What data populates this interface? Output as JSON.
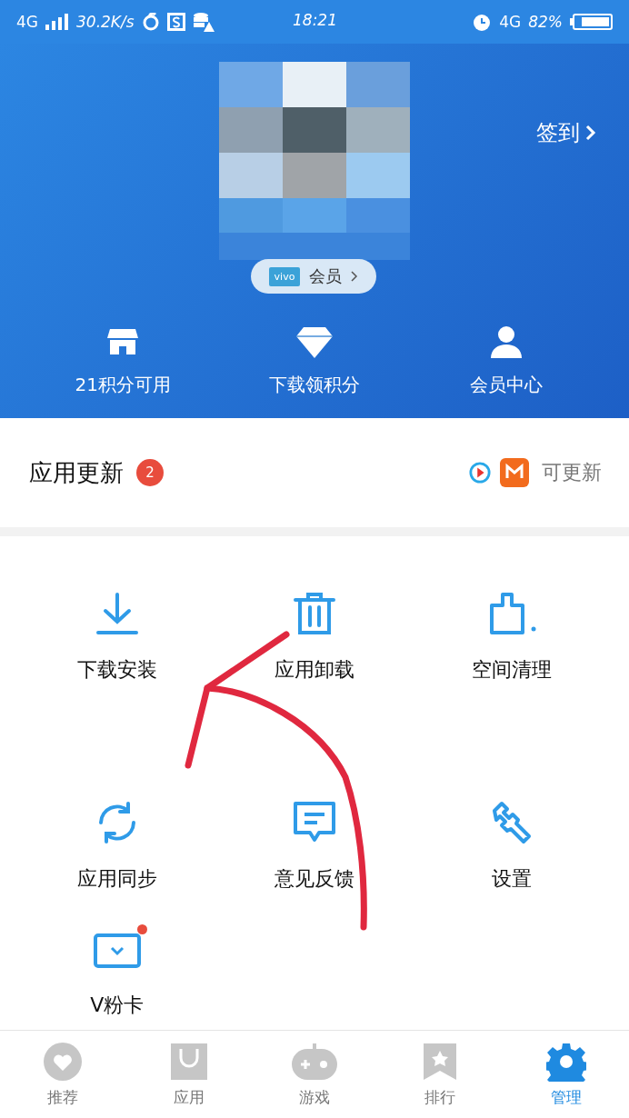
{
  "status_bar": {
    "network": "4G",
    "speed": "30.2K/s",
    "time": "18:21",
    "network_right": "4G",
    "battery": "82%"
  },
  "profile": {
    "checkin": "签到",
    "member_badge": {
      "logo": "vivo",
      "label": "会员"
    },
    "shortcuts": [
      {
        "kind": "shop",
        "label": "21积分可用"
      },
      {
        "kind": "diamond",
        "label": "下载领积分"
      },
      {
        "kind": "person",
        "label": "会员中心"
      }
    ]
  },
  "updates": {
    "title": "应用更新",
    "count": "2",
    "apps": [
      {
        "kind": "play"
      },
      {
        "kind": "tv"
      }
    ],
    "status": "可更新"
  },
  "tools": [
    {
      "kind": "download",
      "label": "下载安装",
      "dot": false
    },
    {
      "kind": "trash",
      "label": "应用卸载",
      "dot": false
    },
    {
      "kind": "brush",
      "label": "空间清理",
      "dot": false
    },
    {
      "kind": "sync",
      "label": "应用同步",
      "dot": false
    },
    {
      "kind": "feedback",
      "label": "意见反馈",
      "dot": false
    },
    {
      "kind": "wrench",
      "label": "设置",
      "dot": false
    },
    {
      "kind": "card",
      "label": "V粉卡",
      "dot": true
    }
  ],
  "nav": [
    {
      "kind": "heart",
      "label": "推荐",
      "selected": false
    },
    {
      "kind": "bag",
      "label": "应用",
      "selected": false
    },
    {
      "kind": "gamepad",
      "label": "游戏",
      "selected": false
    },
    {
      "kind": "ribbon",
      "label": "排行",
      "selected": false
    },
    {
      "kind": "gear",
      "label": "管理",
      "selected": true
    }
  ]
}
